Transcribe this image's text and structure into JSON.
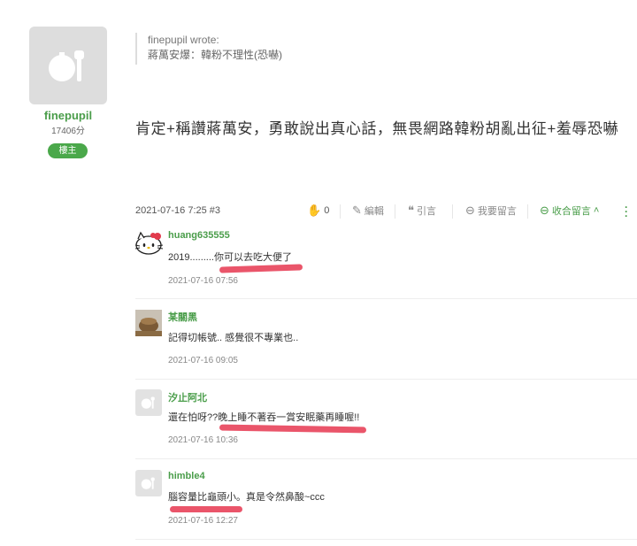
{
  "author": {
    "name": "finepupil",
    "points": "17406分",
    "badge": "樓主"
  },
  "quote": {
    "who": "finepupil wrote:",
    "text": "蔣萬安爆：韓粉不理性(恐嚇)"
  },
  "post": {
    "text": "肯定+稱讚蔣萬安，勇敢說出真心話，無畏網路韓粉胡亂出征+羞辱恐嚇",
    "timestamp": "2021-07-16 7:25 #3",
    "like_count": "0",
    "edit_label": "編輯",
    "quote_label": "引言",
    "comment_label": "我要留言",
    "collapse_label": "收合留言"
  },
  "comments": [
    {
      "name": "huang635555",
      "text": "2019.........你可以去吃大便了",
      "time": "2021-07-16 07:56"
    },
    {
      "name": "某關黑",
      "text": "記得切帳號.. 感覺很不專業也..",
      "time": "2021-07-16 09:05"
    },
    {
      "name": "汐止阿北",
      "text": "還在怕呀??晚上睡不著吞一賞安眠藥再睡喔!!",
      "time": "2021-07-16 10:36"
    },
    {
      "name": "himble4",
      "text": "腦容量比龜頭小。真是令然鼻酸~ccc",
      "time": "2021-07-16 12:27"
    }
  ],
  "colors": {
    "accent": "#4a9d4a",
    "redline": "#e8425a"
  },
  "icons": [
    "hand-icon",
    "pencil-icon",
    "quote-icon",
    "comment-icon",
    "collapse-icon",
    "more-icon"
  ]
}
